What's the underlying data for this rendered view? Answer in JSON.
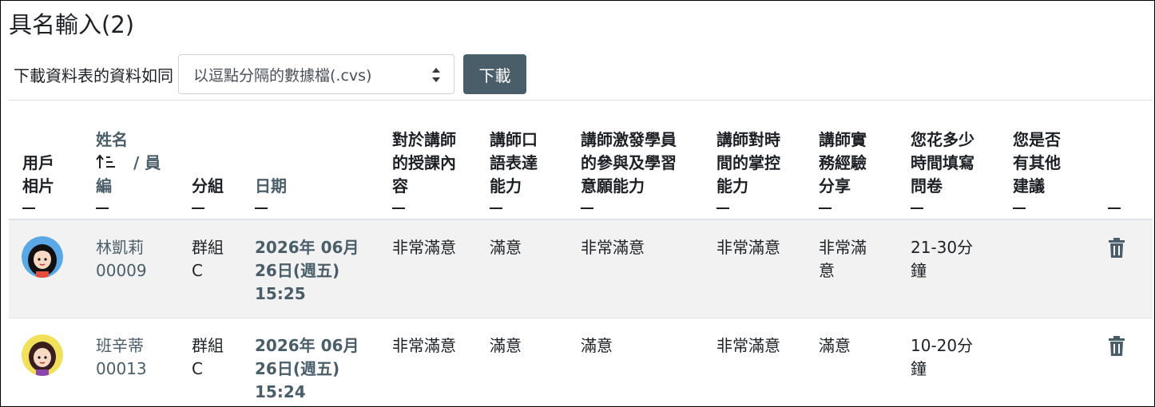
{
  "page": {
    "title": "具名輸入(2)"
  },
  "download": {
    "label": "下載資料表的資料如同",
    "selected_format": "以逗點分隔的數據檔(.cvs)",
    "button_label": "下載"
  },
  "table": {
    "headers": {
      "picture": [
        "用戶",
        "相片"
      ],
      "name_a": "姓名",
      "name_b": "/ 員",
      "name_c": "編",
      "group": "分組",
      "date": "日期",
      "q1": [
        "對於講師",
        "的授課內",
        "容"
      ],
      "q2": [
        "講師口",
        "語表達",
        "能力"
      ],
      "q3": [
        "講師激發學員",
        "的參與及學習",
        "意願能力"
      ],
      "q4": [
        "講師對時",
        "間的掌控",
        "能力"
      ],
      "q5": [
        "講師實",
        "務經驗",
        "分享"
      ],
      "q6": [
        "您花多少",
        "時間填寫",
        "問卷"
      ],
      "q7": [
        "您是否",
        "有其他",
        "建議"
      ]
    },
    "rows": [
      {
        "name": "林凱莉",
        "id": "00009",
        "group": [
          "群組",
          "C"
        ],
        "date": [
          "2026年 06月",
          "26日(週五)",
          "15:25"
        ],
        "q1": "非常滿意",
        "q2": "滿意",
        "q3": "非常滿意",
        "q4": "非常滿意",
        "q5": [
          "非常滿",
          "意"
        ],
        "q6": [
          "21-30分",
          "鐘"
        ],
        "q7": ""
      },
      {
        "name": "班辛蒂",
        "id": "00013",
        "group": [
          "群組",
          "C"
        ],
        "date": [
          "2026年 06月",
          "26日(週五)",
          "15:24"
        ],
        "q1": "非常滿意",
        "q2": "滿意",
        "q3": "滿意",
        "q4": "非常滿意",
        "q5": [
          "滿意"
        ],
        "q6": [
          "10-20分",
          "鐘"
        ],
        "q7": ""
      }
    ]
  },
  "icons": {
    "sort": "sort-ascending-icon",
    "select_arrows": "chevron-up-down-icon",
    "delete": "trash-icon"
  },
  "colors": {
    "button": "#4a5e6a",
    "link": "#4a5e6a",
    "row_alt": "#f2f2f2",
    "border": "#dee2e6"
  }
}
